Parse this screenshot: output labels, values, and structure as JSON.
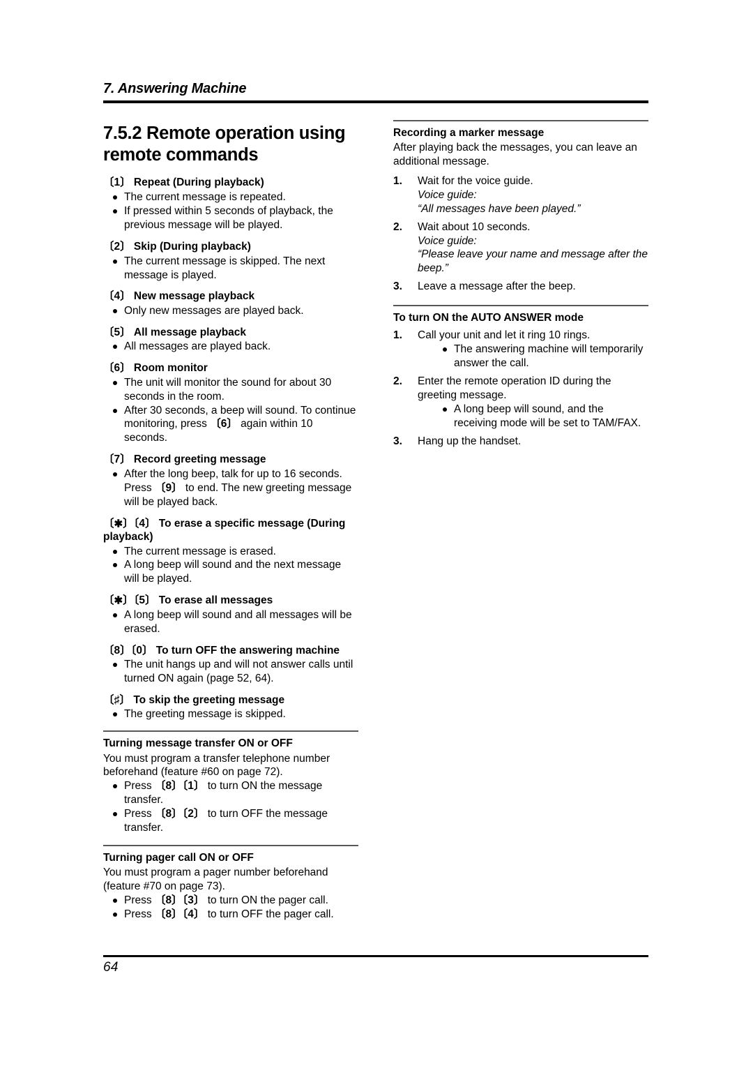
{
  "running_head": {
    "chapter": "7. Answering Machine"
  },
  "footer": {
    "page_number": "64"
  },
  "left_column": {
    "section_number_title": "7.5.2 Remote operation using remote commands",
    "commands": [
      {
        "key_open": "[",
        "key_label": "1",
        "key_close": "]",
        "heading": " Repeat (During playback)",
        "bullets": [
          "The current message is repeated.",
          "If pressed within 5 seconds of playback, the previous message will be played."
        ]
      },
      {
        "key_open": "[",
        "key_label": "2",
        "key_close": "]",
        "heading": " Skip (During playback)",
        "bullets": [
          "The current message is skipped. The next message is played."
        ]
      },
      {
        "key_open": "[",
        "key_label": "4",
        "key_close": "]",
        "heading": " New message playback",
        "bullets": [
          "Only new messages are played back."
        ]
      },
      {
        "key_open": "[",
        "key_label": "5",
        "key_close": "]",
        "heading": " All message playback",
        "bullets": [
          "All messages are played back."
        ]
      },
      {
        "key_open": "[",
        "key_label": "6",
        "key_close": "]",
        "heading": " Room monitor",
        "bullets": [
          "The unit will monitor the sound for about 30 seconds in the room.",
          "After 30 seconds, a beep will sound. To continue monitoring, press [6] again within 10 seconds."
        ]
      },
      {
        "key_open": "[",
        "key_label": "7",
        "key_close": "]",
        "heading": " Record greeting message",
        "bullets": [
          "After the long beep, talk for up to 16 seconds. Press [9] to end. The new greeting message will be played back."
        ]
      }
    ],
    "erase_specific": {
      "keys": "[✱][4]",
      "heading": " To erase a specific message (During playback)",
      "bullets": [
        "The current message is erased.",
        "A long beep will sound and the next message will be played."
      ]
    },
    "erase_all": {
      "keys": "[✱][5]",
      "heading": " To erase all messages",
      "bullets": [
        "A long beep will sound and all messages will be erased."
      ]
    },
    "turn_off_am": {
      "keys": "[8][0]",
      "heading": " To turn OFF the answering machine",
      "bullets": [
        "The unit hangs up and will not answer calls until turned ON again (page 52, 64)."
      ]
    },
    "skip_greeting": {
      "keys": "[♯]",
      "heading": " To skip the greeting message",
      "bullets": [
        "The greeting message is skipped."
      ]
    },
    "message_transfer": {
      "heading": "Turning message transfer ON or OFF",
      "intro": "You must program a transfer telephone number beforehand (feature #60 on page 72).",
      "bullets": [
        {
          "pre": "Press ",
          "keys": "[8][1]",
          "post": " to turn ON the message transfer."
        },
        {
          "pre": "Press ",
          "keys": "[8][2]",
          "post": " to turn OFF the message transfer."
        }
      ]
    },
    "pager_call": {
      "heading": "Turning pager call ON or OFF",
      "intro": "You must program a pager number beforehand (feature #70 on page 73).",
      "bullets": [
        {
          "pre": "Press ",
          "keys": "[8][3]",
          "post": " to turn ON the pager call."
        },
        {
          "pre": "Press ",
          "keys": "[8][4]",
          "post": " to turn OFF the pager call."
        }
      ]
    }
  },
  "right_column": {
    "marker_message": {
      "heading": "Recording a marker message",
      "intro": "After playing back the messages, you can leave an additional message.",
      "steps": [
        {
          "num": "1.",
          "text": "Wait for the voice guide.",
          "voice_label": "Voice guide:",
          "voice_quote": "“All messages have been played.”"
        },
        {
          "num": "2.",
          "text": "Wait about 10 seconds.",
          "voice_label": "Voice guide:",
          "voice_quote": "“Please leave your name and message after the beep.”"
        },
        {
          "num": "3.",
          "text": "Leave a message after the beep.",
          "voice_label": "",
          "voice_quote": ""
        }
      ]
    },
    "auto_answer": {
      "heading": "To turn ON the AUTO ANSWER mode",
      "steps": [
        {
          "num": "1.",
          "text": "Call your unit and let it ring 10 rings.",
          "bullets": [
            "The answering machine will temporarily answer the call."
          ]
        },
        {
          "num": "2.",
          "text": "Enter the remote operation ID during the greeting message.",
          "bullets": [
            "A long beep will sound, and the receiving mode will be set to TAM/FAX."
          ]
        },
        {
          "num": "3.",
          "text": "Hang up the handset.",
          "bullets": []
        }
      ]
    }
  }
}
